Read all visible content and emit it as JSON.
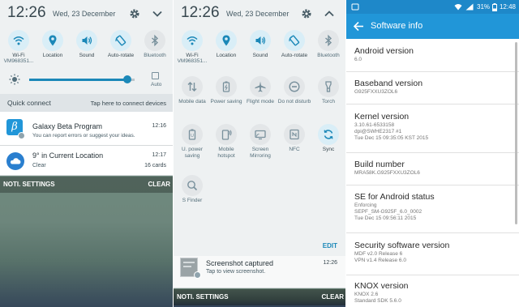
{
  "left_panel": {
    "time": "12:26",
    "date": "Wed, 23 December",
    "toggles": [
      {
        "label": "Wi-Fi",
        "sub": "VM968351...",
        "icon": "wifi-icon"
      },
      {
        "label": "Location",
        "icon": "location-icon"
      },
      {
        "label": "Sound",
        "icon": "sound-icon"
      },
      {
        "label": "Auto-rotate",
        "icon": "auto-rotate-icon"
      },
      {
        "label": "Bluetooth",
        "icon": "bluetooth-icon"
      }
    ],
    "brightness_level": 0.93,
    "brightness_auto_label": "Auto",
    "quick_connect": {
      "label": "Quick connect",
      "hint": "Tap here to connect devices"
    },
    "notifications": [
      {
        "title": "Galaxy Beta Program",
        "time": "12:16",
        "body": "You can report errors or suggest your ideas.",
        "icon": "beta-icon"
      },
      {
        "title": "9° in Current Location",
        "time": "12:17",
        "body": "Clear",
        "count": "16 cards",
        "icon": "weather-cloud-icon"
      }
    ],
    "bottom_bar": {
      "settings": "NOTI. SETTINGS",
      "clear": "CLEAR"
    }
  },
  "middle_panel": {
    "time": "12:26",
    "date": "Wed, 23 December",
    "toggles": [
      {
        "label": "Wi-Fi",
        "sub": "VM968351...",
        "icon": "wifi-icon"
      },
      {
        "label": "Location",
        "icon": "location-icon"
      },
      {
        "label": "Sound",
        "icon": "sound-icon"
      },
      {
        "label": "Auto-rotate",
        "icon": "auto-rotate-icon"
      },
      {
        "label": "Bluetooth",
        "icon": "bluetooth-icon"
      },
      {
        "label": "Mobile data",
        "icon": "mobile-data-icon"
      },
      {
        "label": "Power saving",
        "icon": "power-saving-icon"
      },
      {
        "label": "Flight mode",
        "icon": "flight-mode-icon"
      },
      {
        "label": "Do not disturb",
        "icon": "do-not-disturb-icon"
      },
      {
        "label": "Torch",
        "icon": "torch-icon"
      },
      {
        "label": "U. power saving",
        "icon": "ultra-power-saving-icon"
      },
      {
        "label": "Mobile hotspot",
        "icon": "mobile-hotspot-icon"
      },
      {
        "label": "Screen Mirroring",
        "icon": "screen-mirroring-icon"
      },
      {
        "label": "NFC",
        "icon": "nfc-icon"
      },
      {
        "label": "Sync",
        "icon": "sync-icon"
      },
      {
        "label": "S Finder",
        "icon": "s-finder-icon"
      }
    ],
    "edit_label": "EDIT",
    "notification": {
      "title": "Screenshot captured",
      "time": "12:26",
      "body": "Tap to view screenshot."
    },
    "bottom_bar": {
      "settings": "NOTI. SETTINGS",
      "clear": "CLEAR"
    }
  },
  "right_panel": {
    "status": {
      "battery": "31%",
      "time": "12:48"
    },
    "title": "Software info",
    "items": [
      {
        "title": "Android version",
        "lines": [
          "6.0"
        ]
      },
      {
        "title": "Baseband version",
        "lines": [
          "G925FXXU3ZOL6"
        ]
      },
      {
        "title": "Kernel version",
        "lines": [
          "3.10.61-6533158",
          "dpi@SWHE2317 #1",
          "Tue Dec 15 09:35:05 KST 2015"
        ]
      },
      {
        "title": "Build number",
        "lines": [
          "MRA58K.G925FXXU3ZOL6"
        ]
      },
      {
        "title": "SE for Android status",
        "lines": [
          "Enforcing",
          "SEPF_SM-G925F_6.0_0002",
          "Tue Dec 15 09:56:11 2015"
        ]
      },
      {
        "title": "Security software version",
        "lines": [
          "MDF v2.0 Release 6",
          "VPN v1.4 Release 6.0"
        ]
      },
      {
        "title": "KNOX version",
        "lines": [
          "KNOX 2.6",
          "Standard SDK 5.6.0"
        ]
      }
    ]
  }
}
